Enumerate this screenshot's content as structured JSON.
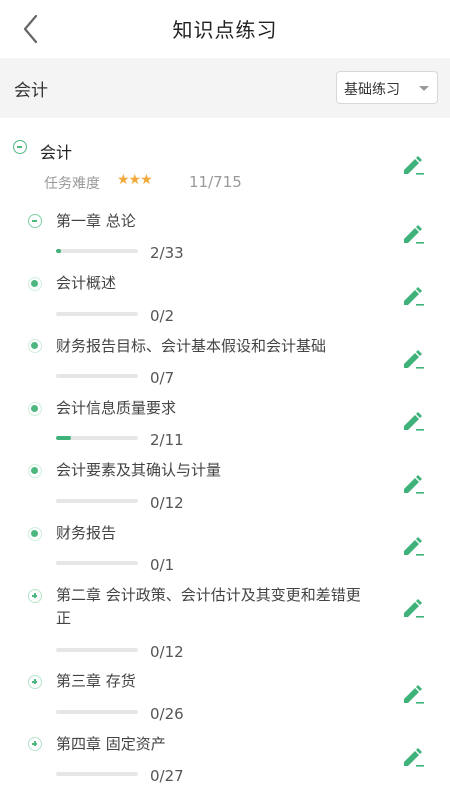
{
  "header": {
    "title": "知识点练习",
    "back_icon": "chevron-left-icon"
  },
  "subject_bar": {
    "subject": "会计",
    "mode": "基础练习"
  },
  "root": {
    "title": "会计",
    "difficulty_label": "任务难度",
    "stars": "★★★",
    "count": "11/715"
  },
  "nodes": [
    {
      "title": "第一章 总论",
      "count": "2/33",
      "progress": 0.06,
      "state": "minus"
    },
    {
      "title": "会计概述",
      "count": "0/2",
      "progress": 0,
      "state": "dot"
    },
    {
      "title": "财务报告目标、会计基本假设和会计基础",
      "count": "0/7",
      "progress": 0,
      "state": "dot"
    },
    {
      "title": "会计信息质量要求",
      "count": "2/11",
      "progress": 0.18,
      "state": "dot"
    },
    {
      "title": "会计要素及其确认与计量",
      "count": "0/12",
      "progress": 0,
      "state": "dot"
    },
    {
      "title": "财务报告",
      "count": "0/1",
      "progress": 0,
      "state": "dot"
    },
    {
      "title": "第二章 会计政策、会计估计及其变更和差错更正",
      "count": "0/12",
      "progress": 0,
      "state": "plus"
    },
    {
      "title": "第三章 存货",
      "count": "0/26",
      "progress": 0,
      "state": "plus"
    },
    {
      "title": "第四章 固定资产",
      "count": "0/27",
      "progress": 0,
      "state": "plus"
    }
  ],
  "colors": {
    "accent": "#3fb27a",
    "star": "#f2a93b"
  }
}
